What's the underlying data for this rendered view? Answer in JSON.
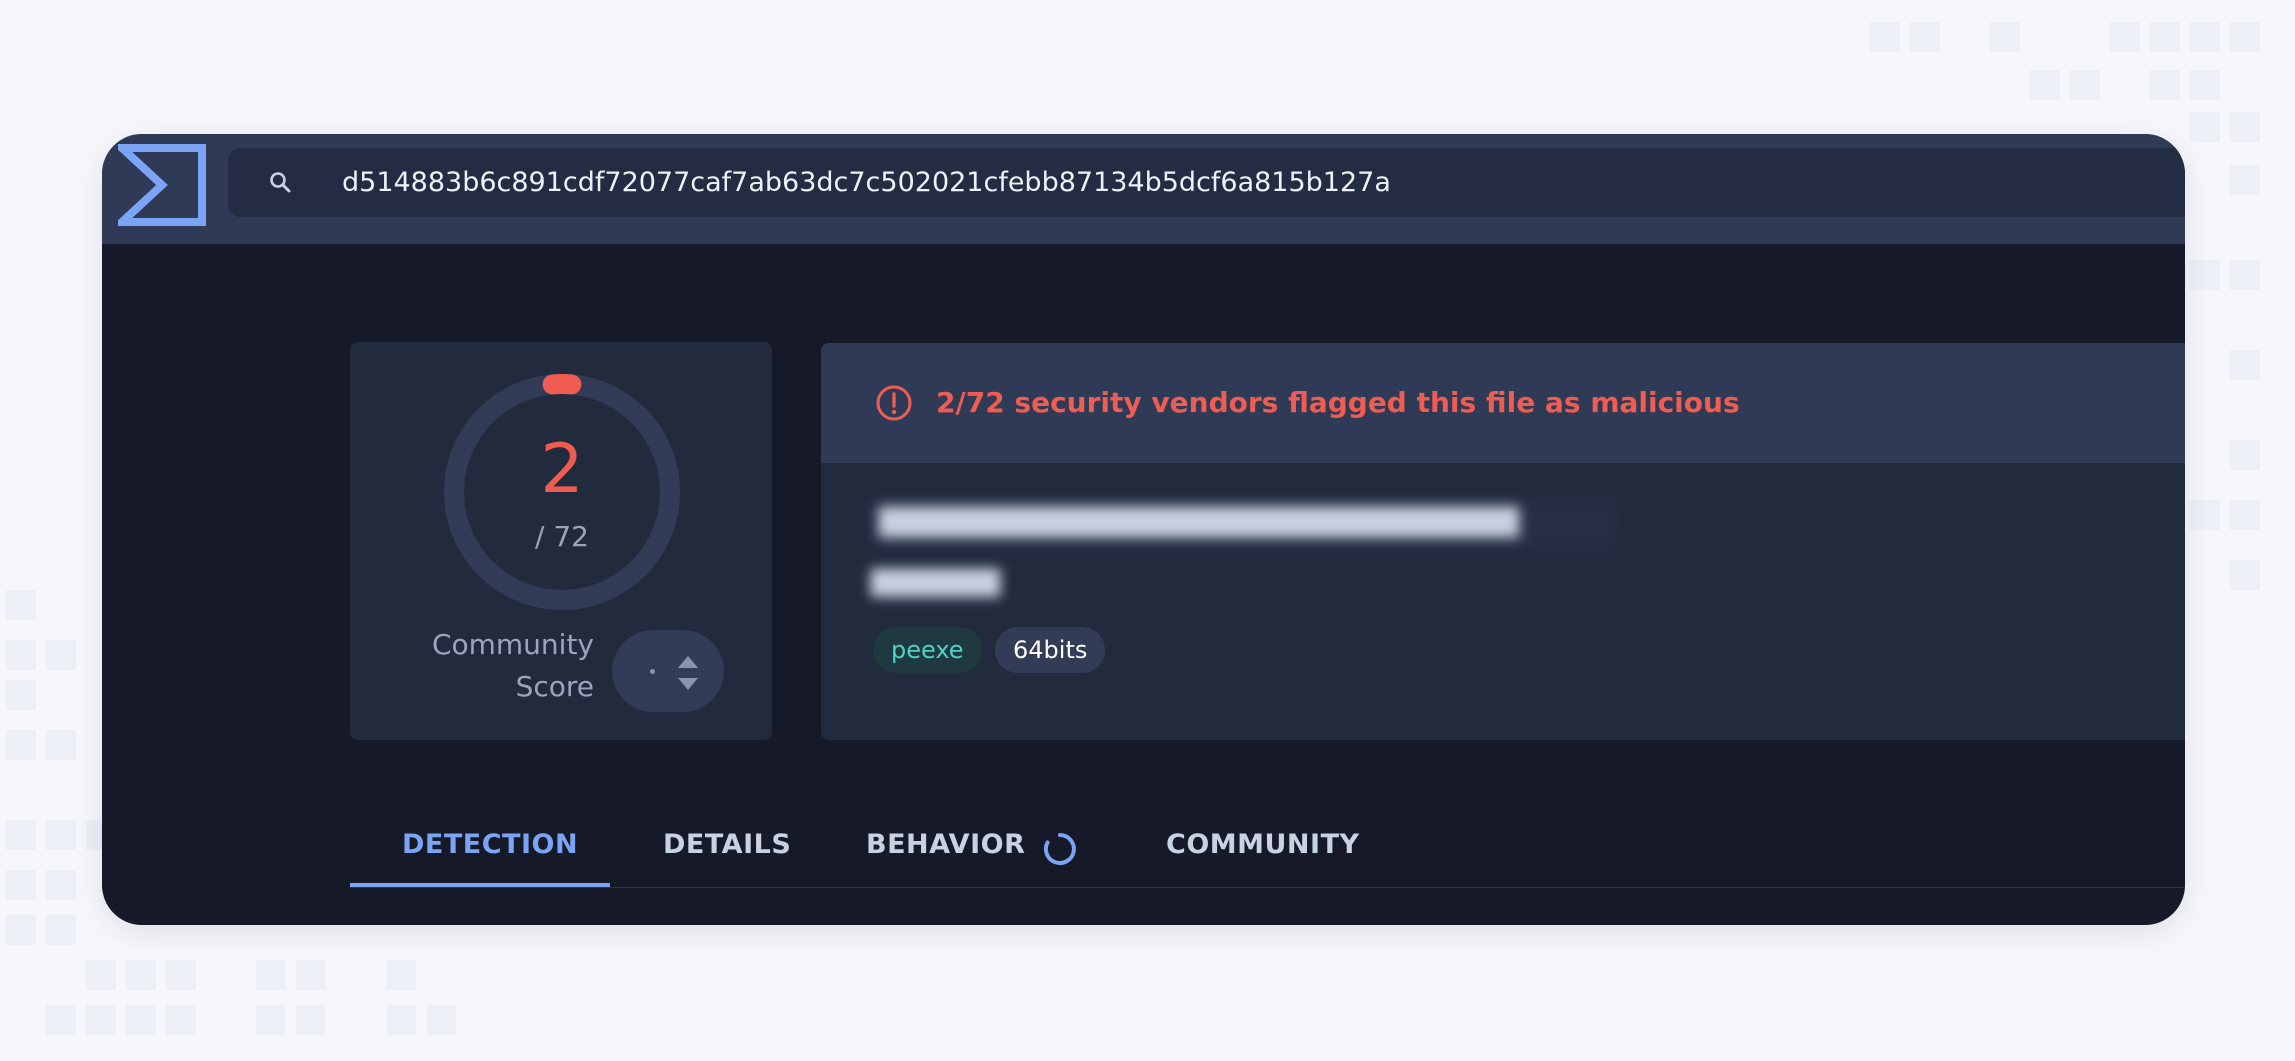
{
  "search": {
    "query": "d514883b6c891cdf72077caf7ab63dc7c502021cfebb87134b5dcf6a815b127a"
  },
  "score": {
    "detections": "2",
    "total": "/ 72",
    "detections_value": 2,
    "total_value": 72,
    "community_label_line1": "Community",
    "community_label_line2": "Score"
  },
  "alert": {
    "message": "2/72 security vendors flagged this file as malicious"
  },
  "file": {
    "tags": [
      "peexe",
      "64bits"
    ]
  },
  "tabs": [
    {
      "label": "DETECTION",
      "active": true
    },
    {
      "label": "DETAILS",
      "active": false
    },
    {
      "label": "BEHAVIOR",
      "active": false
    },
    {
      "label": "COMMUNITY",
      "active": false
    }
  ],
  "colors": {
    "malicious": "#ee5c52",
    "accent": "#7ba4f6",
    "tag_peexe": "#4fd1c5",
    "panel": "#222a3e",
    "header": "#2f3b56"
  },
  "icons": {
    "logo": "sigma-logo-icon",
    "search": "search-icon",
    "alert": "alert-circle-icon",
    "loading": "spinner-icon"
  }
}
